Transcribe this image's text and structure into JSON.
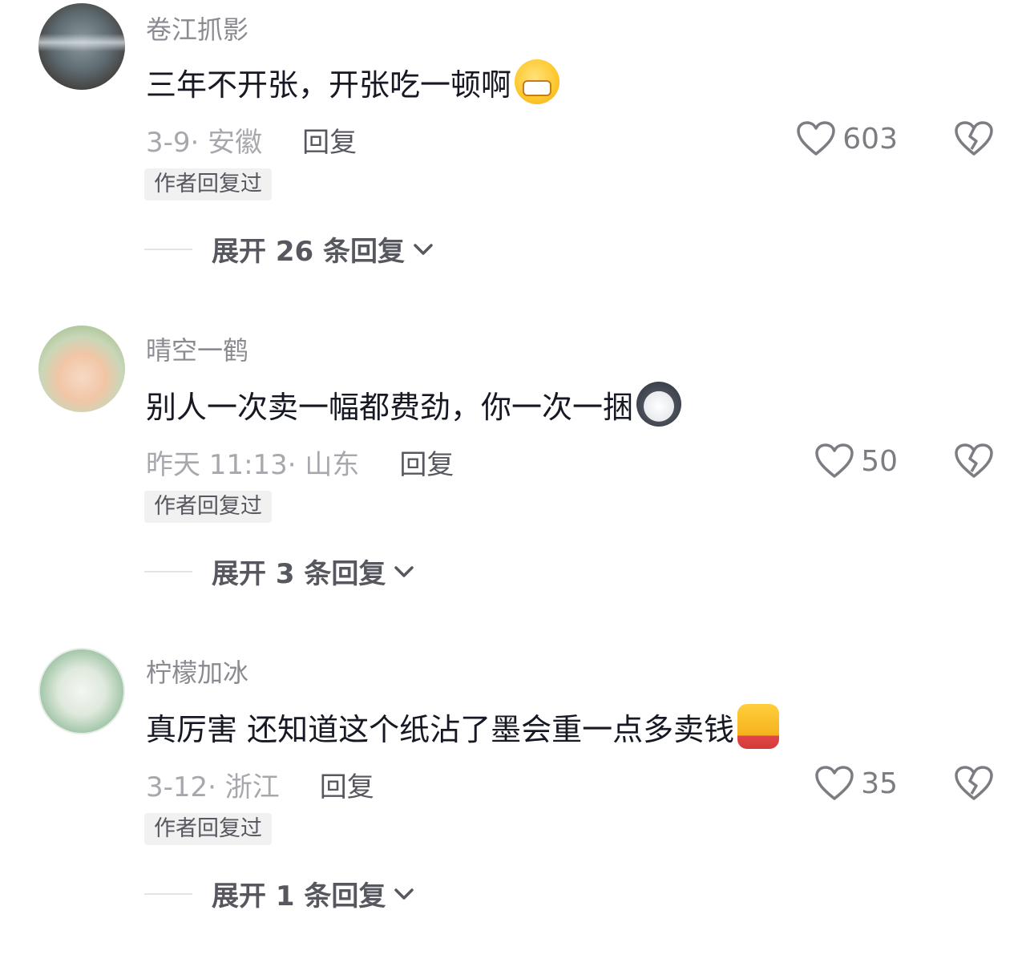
{
  "comments": [
    {
      "username": "卷江抓影",
      "text": "三年不开张，开张吃一顿啊",
      "emoji": "grinning-emoji",
      "meta": "3-9· 安徽",
      "reply_label": "回复",
      "likes": "603",
      "badge": "作者回复过",
      "expand_label": "展开 26 条回复"
    },
    {
      "username": "晴空一鹤",
      "text": "别人一次卖一幅都费劲，你一次一捆",
      "emoji": "husky-emoji",
      "meta": "昨天 11:13· 山东",
      "reply_label": "回复",
      "likes": "50",
      "badge": "作者回复过",
      "expand_label": "展开 3 条回复"
    },
    {
      "username": "柠檬加冰",
      "text": "真厉害  还知道这个纸沾了墨会重一点多卖钱",
      "emoji": "thumbs-up-emoji",
      "meta": "3-12· 浙江",
      "reply_label": "回复",
      "likes": "35",
      "badge": "作者回复过",
      "expand_label": "展开 1 条回复"
    }
  ]
}
